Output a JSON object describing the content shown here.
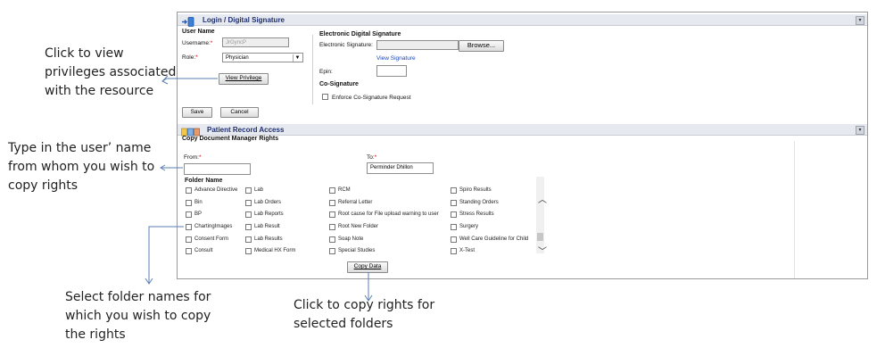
{
  "annotations": {
    "privileges": [
      "Click to view",
      "privileges associated",
      "with the resource"
    ],
    "user_name": [
      "Type in the user’ name",
      "from whom you wish to",
      "copy rights"
    ],
    "folders": [
      "Select folder names for",
      "which you wish to copy",
      "the rights"
    ],
    "copy": [
      "Click to copy rights for",
      "selected folders"
    ]
  },
  "login_section": {
    "title": "Login / Digital Signature",
    "user_name_heading": "User Name",
    "username_label": "Username:",
    "username_value": "JrGyncP",
    "role_label": "Role:",
    "role_value": "Physician",
    "view_privilege": "View Privilege",
    "save": "Save",
    "cancel": "Cancel"
  },
  "signature": {
    "heading": "Electronic Digital Signature",
    "es_label": "Electronic Signature:",
    "browse": "Browse...",
    "view_signature": "View Signature",
    "epin_label": "Epin:",
    "cosign_heading": "Co-Signature",
    "enforce_label": "Enforce Co-Signature Request"
  },
  "patient_record": {
    "title": "Patient Record Access",
    "copy_heading": "Copy Document Manager Rights",
    "from_label": "From:",
    "from_value": "",
    "to_label": "To:",
    "to_value": "Perminder Dhillon",
    "folder_heading": "Folder Name",
    "columns": [
      [
        "Advance Directive",
        "Bin",
        "BP",
        "ChartingImages",
        "Consent Form",
        "Consult"
      ],
      [
        "Lab",
        "Lab Orders",
        "Lab Reports",
        "Lab Result",
        "Lab Results",
        "Medical HX Form"
      ],
      [
        "RCM",
        "Referral Letter",
        "Root cause for File upload warning to user",
        "Root New Folder",
        "Soap Note",
        "Special Studies"
      ],
      [
        "Spiro Results",
        "Standing Orders",
        "Stress Results",
        "Surgery",
        "Well Care Guideline for Child",
        "X-Test"
      ]
    ],
    "copy_data": "Copy Data"
  },
  "icons": {
    "login": "login-icon",
    "patient": "patient-record-icon",
    "collapse": "collapse-icon",
    "dropdown": "chevron-down-icon",
    "scroll_up": "chevron-up-icon",
    "scroll_down": "chevron-down-icon"
  }
}
